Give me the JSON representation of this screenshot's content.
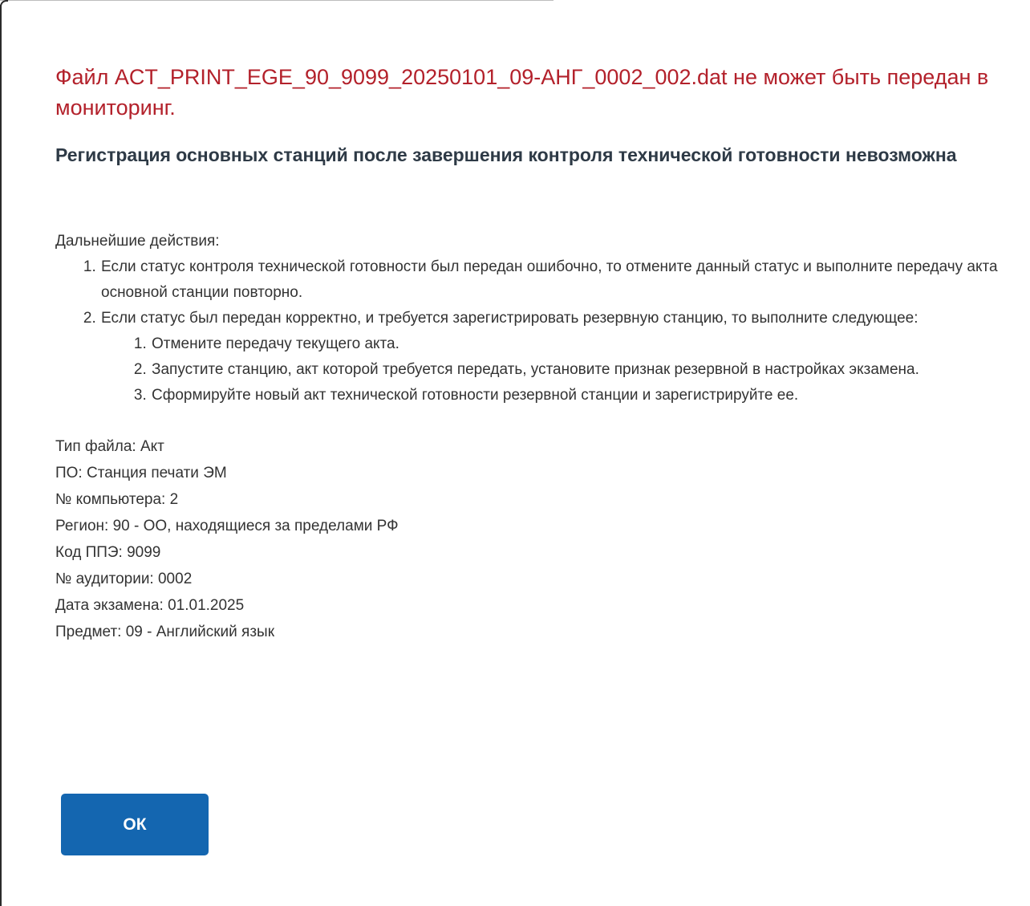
{
  "dialog": {
    "title": "Файл ACT_PRINT_EGE_90_9099_20250101_09-АНГ_0002_002.dat не может быть передан в мониторинг.",
    "subtitle": "Регистрация основных станций после завершения контроля технической готовности невозможна",
    "actions_heading": "Дальнейшие действия:",
    "steps": [
      {
        "text": "Если статус контроля технической готовности был передан ошибочно, то отмените данный статус и выполните передачу акта основной станции повторно."
      },
      {
        "text": "Если статус был передан корректно, и требуется зарегистрировать резервную станцию, то выполните следующее:",
        "substeps": [
          "Отмените передачу текущего акта.",
          "Запустите станцию, акт которой требуется передать, установите признак резервной в настройках экзамена.",
          "Сформируйте новый акт технической готовности резервной станции и зарегистрируйте ее."
        ]
      }
    ],
    "info": [
      "Тип файла: Акт",
      "ПО: Станция печати ЭМ",
      "№ компьютера: 2",
      "Регион: 90 - ОО, находящиеся за пределами РФ",
      "Код ППЭ: 9099",
      "№ аудитории: 0002",
      "Дата экзамена: 01.01.2025",
      "Предмет: 09 - Английский язык"
    ],
    "ok_label": "ОК"
  },
  "colors": {
    "title": "#b3212b",
    "subtitle": "#2e3a46",
    "body_text": "#333333",
    "button_bg": "#1466b0",
    "button_text": "#ffffff"
  }
}
